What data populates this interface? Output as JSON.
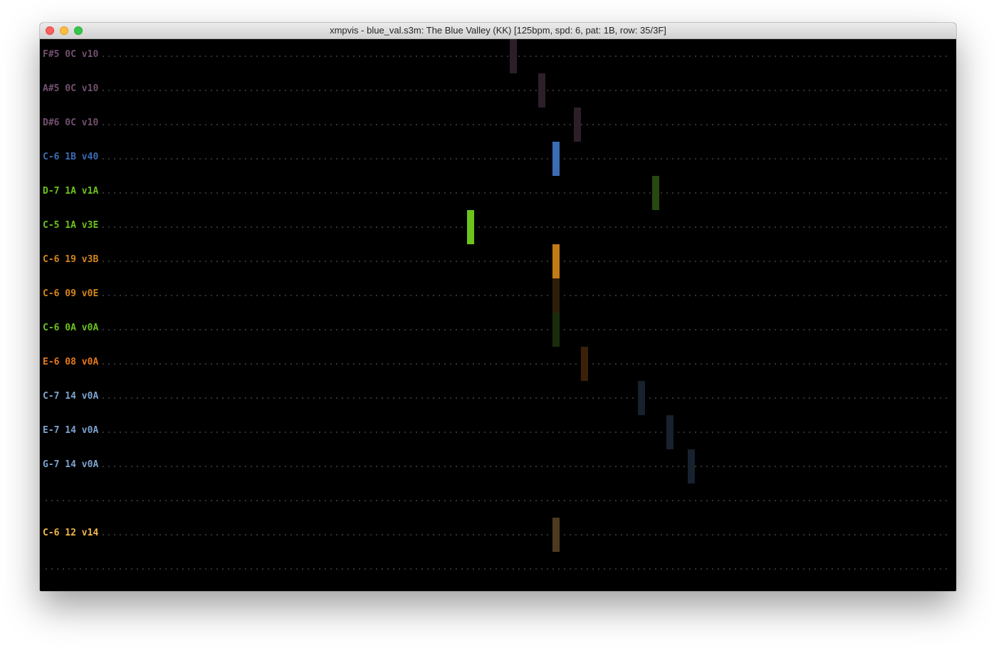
{
  "window": {
    "title": "xmpvis - blue_val.s3m: The Blue Valley (KK) [125bpm, spd: 6, pat: 1B, row: 35/3F]"
  },
  "channels": [
    {
      "label": "F#5 0C v10",
      "color": "#72506f",
      "bar_color": "#2c1f2a",
      "bar_col": 66
    },
    {
      "label": "A#5 0C v10",
      "color": "#72506f",
      "bar_color": "#2c1f2a",
      "bar_col": 70
    },
    {
      "label": "D#6 0C v10",
      "color": "#72506f",
      "bar_color": "#2c1f2a",
      "bar_col": 75
    },
    {
      "label": "C-6 1B v40",
      "color": "#3b6cb4",
      "bar_color": "#3b6cb4",
      "bar_col": 72
    },
    {
      "label": "D-7 1A v1A",
      "color": "#6dc31b",
      "bar_color": "#27480f",
      "bar_col": 86
    },
    {
      "label": "C-5 1A v3E",
      "color": "#6dc31b",
      "bar_color": "#6dc31b",
      "bar_col": 60
    },
    {
      "label": "C-6 19 v3B",
      "color": "#d5861b",
      "bar_color": "#c27a15",
      "bar_col": 72
    },
    {
      "label": "C-6 09 v0E",
      "color": "#d5861b",
      "bar_color": "#2d1e0a",
      "bar_col": 72
    },
    {
      "label": "C-6 0A v0A",
      "color": "#6dc31b",
      "bar_color": "#192d0c",
      "bar_col": 72
    },
    {
      "label": "E-6 08 v0A",
      "color": "#e8781a",
      "bar_color": "#3b2108",
      "bar_col": 76
    },
    {
      "label": "C-7 14 v0A",
      "color": "#7da3cf",
      "bar_color": "#18212e",
      "bar_col": 84
    },
    {
      "label": "E-7 14 v0A",
      "color": "#7da3cf",
      "bar_color": "#18212e",
      "bar_col": 88
    },
    {
      "label": "G-7 14 v0A",
      "color": "#7da3cf",
      "bar_color": "#18212e",
      "bar_col": 91
    },
    {
      "label": "",
      "color": "#000000",
      "bar_color": "",
      "bar_col": null
    },
    {
      "label": "C-6 12 v14",
      "color": "#f0b64c",
      "bar_color": "#4d3b20",
      "bar_col": 72
    },
    {
      "label": "",
      "color": "#000000",
      "bar_color": "",
      "bar_col": null
    }
  ]
}
